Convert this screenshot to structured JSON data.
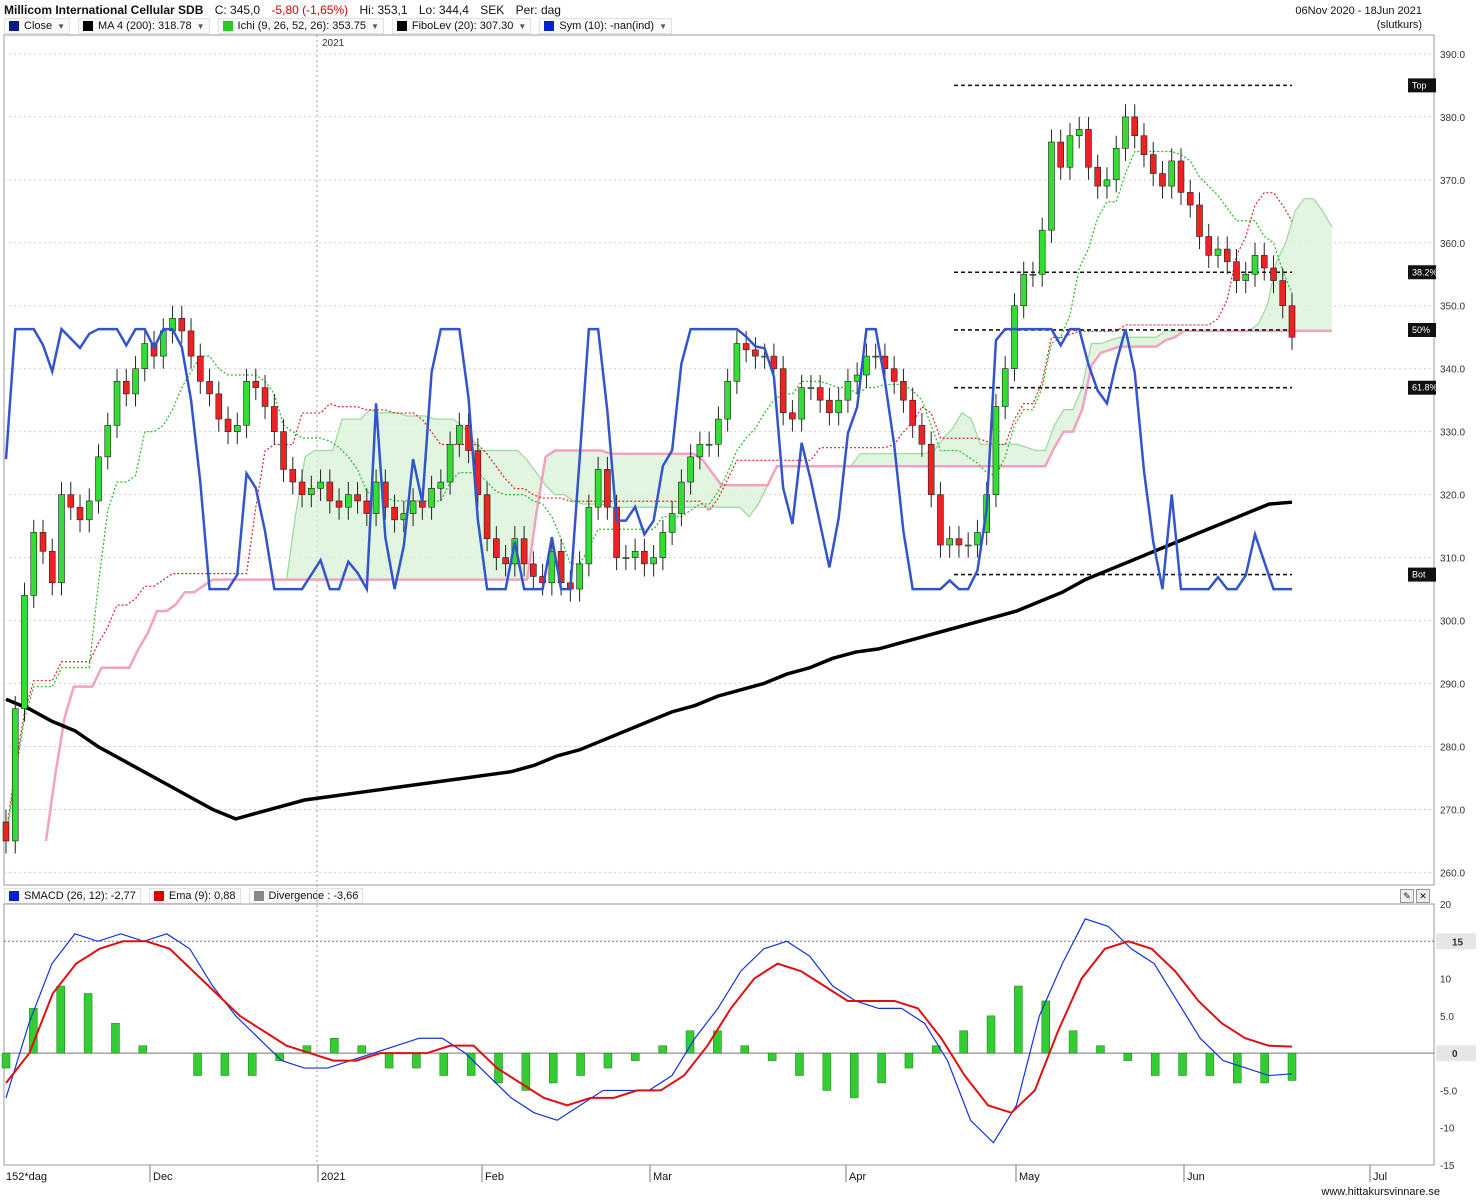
{
  "header": {
    "title": "Millicom International Cellular SDB",
    "close": "C: 345,0",
    "change": "-5,80 (-1,65%)",
    "high": "Hi: 353,1",
    "low": "Lo: 344,4",
    "currency": "SEK",
    "period": "Per: dag",
    "date_range": "06Nov 2020 - 18Jun 2021",
    "mode": "(slutkurs)"
  },
  "legend_main": [
    {
      "label": "Close",
      "color": "#0a1a8a"
    },
    {
      "label": "MA 4 (200): 318.78",
      "color": "#000000"
    },
    {
      "label": "Ichi (9, 26, 52, 26): 353.75",
      "color": "#22cc22"
    },
    {
      "label": "FiboLev (20): 307.30",
      "color": "#000000"
    },
    {
      "label": "Sym (10): -nan(ind)",
      "color": "#0022cc"
    }
  ],
  "legend_macd": [
    {
      "label": "SMACD (26, 12): -2,77",
      "color": "#0022cc"
    },
    {
      "label": "Ema (9): 0,88",
      "color": "#dd0000"
    },
    {
      "label": "Divergence : -3,66",
      "color": "#888888"
    }
  ],
  "year_label": "2021",
  "bottom_left": "152*dag",
  "footer": "www.hittakursvinnare.se",
  "fib_labels": {
    "top": "Top",
    "f382": "38.2%",
    "f50": "50%",
    "f618": "61.8%",
    "bot": "Bot"
  },
  "macd_ref_labels": [
    "15",
    "0"
  ],
  "chart_data": [
    {
      "type": "line",
      "description_none": "",
      "x_labels": [
        "Dec",
        "2021",
        "Feb",
        "Mar",
        "Apr",
        "May",
        "Jun",
        "Jul"
      ],
      "y_ticks": [
        "390.0",
        "380.0",
        "370.0",
        "360.0",
        "350.0",
        "340.0",
        "330.0",
        "320.0",
        "310.0",
        "300.0",
        "290.0",
        "280.0",
        "270.0",
        "260.0"
      ],
      "ylim": [
        258,
        393
      ],
      "series": [
        {
          "name": "Close",
          "values": [
            265,
            286,
            304,
            314,
            311,
            306,
            320,
            318,
            316,
            319,
            326,
            331,
            338,
            336,
            340,
            344,
            342,
            346,
            348,
            346,
            342,
            338,
            336,
            332,
            330,
            331,
            338,
            337,
            334,
            330,
            324,
            322,
            320,
            321,
            322,
            319,
            318,
            320,
            319,
            317,
            322,
            318,
            316,
            317,
            319,
            318,
            321,
            322,
            328,
            331,
            327,
            320,
            313,
            310,
            309,
            313,
            309,
            307,
            306,
            311,
            306,
            305,
            309,
            318,
            324,
            318,
            310,
            310,
            311,
            309,
            310,
            314,
            317,
            322,
            326,
            328,
            328,
            332,
            338,
            344,
            343,
            342,
            342,
            340,
            333,
            332,
            337,
            337,
            335,
            333,
            335,
            338,
            339,
            342,
            342,
            340,
            338,
            335,
            331,
            328,
            320,
            312,
            313,
            312,
            312,
            314,
            320,
            334,
            340,
            350,
            355,
            355,
            362,
            376,
            372,
            377,
            378,
            372,
            369,
            370,
            375,
            380,
            377,
            374,
            371,
            369,
            373,
            368,
            366,
            361,
            358,
            359,
            357,
            354,
            355,
            358,
            356,
            354,
            350,
            345
          ]
        },
        {
          "name": "MA 4 (200)",
          "values": [
            287.5,
            286,
            284,
            282.5,
            280,
            278,
            276,
            274,
            272,
            270,
            268.5,
            269.5,
            270.5,
            271.5,
            272,
            272.5,
            273,
            273.5,
            274,
            274.5,
            275,
            275.5,
            276,
            277,
            278.5,
            279.5,
            281,
            282.5,
            284,
            285.5,
            286.5,
            288,
            289,
            290,
            291.5,
            292.5,
            294,
            295,
            295.5,
            296.5,
            297.5,
            298.5,
            299.5,
            300.5,
            301.5,
            303,
            304.5,
            306.5,
            308,
            309.5,
            311,
            312.5,
            314,
            315.5,
            317,
            318.5,
            318.8
          ]
        }
      ]
    },
    {
      "type": "bar",
      "ylim": [
        -15,
        20
      ],
      "y_ticks": [
        "20",
        "15",
        "10",
        "5.0",
        "0",
        "-5.0",
        "-10",
        "-15"
      ],
      "series": [
        {
          "name": "SMACD (26, 12)",
          "values": [
            -6,
            4,
            12,
            16,
            15,
            16,
            15,
            16,
            14,
            9,
            5,
            2,
            -1,
            -2,
            -2,
            -1,
            0,
            1,
            2,
            2,
            0,
            -3,
            -6,
            -8,
            -9,
            -7,
            -5,
            -5,
            -5,
            -3,
            2,
            6,
            11,
            14,
            15,
            13,
            9,
            7,
            6,
            6,
            4,
            -1,
            -9,
            -12,
            -7,
            5,
            12,
            18,
            17,
            14,
            12,
            7,
            2,
            -1,
            -2,
            -3,
            -2.77
          ]
        },
        {
          "name": "Ema (9)",
          "values": [
            -4,
            0,
            8,
            12,
            14,
            15,
            15,
            14,
            11,
            8,
            5,
            3,
            1,
            0,
            -1,
            -1,
            0,
            0,
            0,
            1,
            1,
            -2,
            -4,
            -6,
            -7,
            -6,
            -6,
            -5,
            -5,
            -3,
            1,
            6,
            10,
            12,
            11,
            9,
            7,
            7,
            7,
            6,
            2,
            -3,
            -7,
            -8,
            -5,
            3,
            10,
            14,
            15,
            14,
            11,
            7,
            4,
            2,
            1,
            0.88
          ]
        },
        {
          "name": "Divergence",
          "values": [
            -2,
            6,
            9,
            8,
            4,
            1,
            0,
            -3,
            -3,
            -3,
            -1,
            1,
            2,
            1,
            -2,
            -2,
            -3,
            -3,
            -4,
            -5,
            -4,
            -3,
            -2,
            -1,
            1,
            3,
            3,
            1,
            -1,
            -3,
            -5,
            -6,
            -4,
            -2,
            1,
            3,
            5,
            9,
            7,
            3,
            1,
            -1,
            -3,
            -3,
            -3,
            -4,
            -4,
            -3.66
          ]
        }
      ]
    }
  ]
}
